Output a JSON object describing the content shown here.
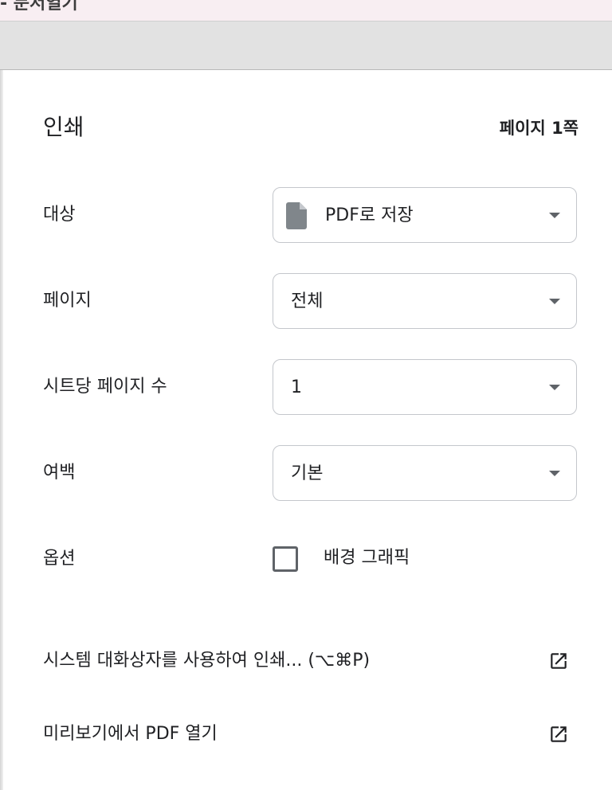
{
  "top_bar": {
    "partial_title": "- 문서열기"
  },
  "dialog": {
    "title": "인쇄",
    "page_count": "페이지 1쪽"
  },
  "fields": {
    "destination": {
      "label": "대상",
      "value": "PDF로 저장",
      "icon": "document-icon"
    },
    "pages": {
      "label": "페이지",
      "value": "전체"
    },
    "pages_per_sheet": {
      "label": "시트당 페이지 수",
      "value": "1"
    },
    "margins": {
      "label": "여백",
      "value": "기본"
    },
    "options": {
      "label": "옵션",
      "checkbox_label": "배경 그래픽",
      "checked": false
    }
  },
  "links": {
    "system_dialog": {
      "label": "시스템 대화상자를 사용하여 인쇄... (⌥⌘P)",
      "icon": "open-in-new-icon"
    },
    "open_preview": {
      "label": "미리보기에서 PDF 열기",
      "icon": "open-in-new-icon"
    }
  },
  "colors": {
    "text": "#202124",
    "icon": "#5f6368",
    "border": "#c4c7cc",
    "top_strip": "#f8eef2",
    "gray_band": "#e2e2e2"
  }
}
